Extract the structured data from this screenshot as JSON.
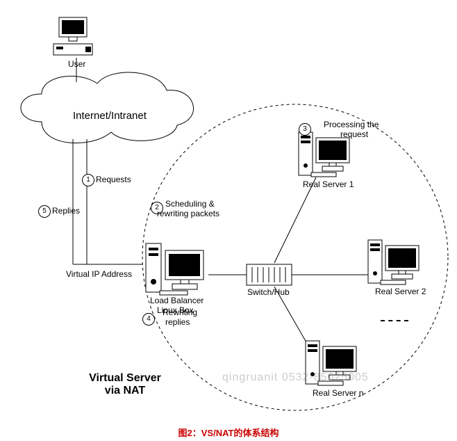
{
  "nodes": {
    "user": {
      "label": "User"
    },
    "cloud": {
      "label": "Internet/Intranet"
    },
    "lb": {
      "label1": "Load Balancer",
      "label2": "Linux Box",
      "vip": "Virtual IP Address"
    },
    "switch": {
      "label": "Switch/Hub"
    },
    "rs1": {
      "label": "Real Server 1"
    },
    "rs2": {
      "label": "Real Server 2"
    },
    "rsn": {
      "label": "Real Server n"
    }
  },
  "steps": {
    "s1": {
      "num": "1",
      "text": "Requests"
    },
    "s2": {
      "num": "2",
      "text1": "Scheduling &",
      "text2": "rewriting packets"
    },
    "s3": {
      "num": "3",
      "text1": "Processing the",
      "text2": "request"
    },
    "s4": {
      "num": "4",
      "text1": "Rewriting",
      "text2": "replies"
    },
    "s5": {
      "num": "5",
      "text": "Replies"
    }
  },
  "title": {
    "line1": "Virtual Server",
    "line2": "via NAT"
  },
  "caption": "图2：VS/NAT的体系结构",
  "watermark": "qingruanit        0532-85025005"
}
